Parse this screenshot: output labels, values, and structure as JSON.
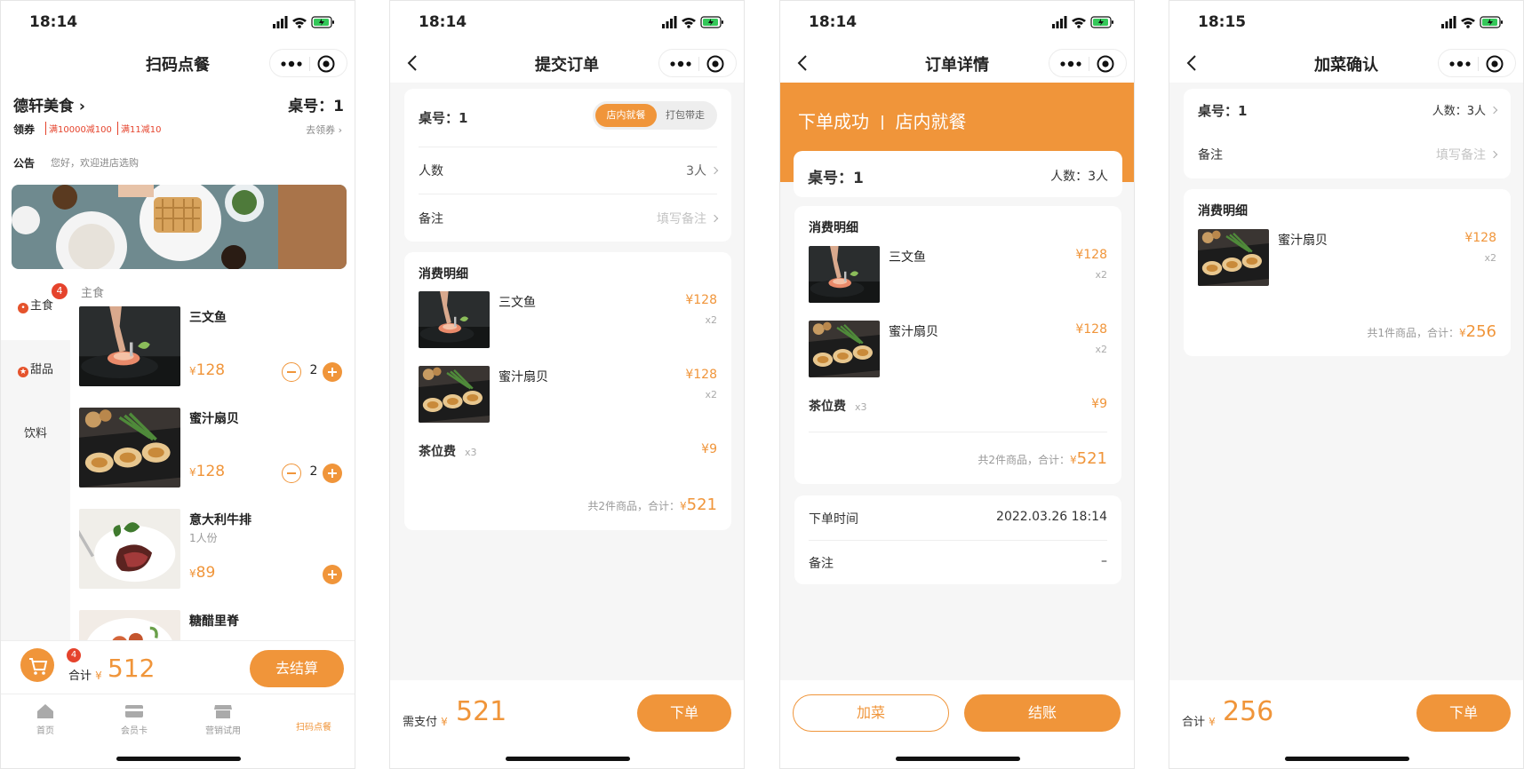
{
  "status": {
    "time1": "18:14",
    "time2": "18:14",
    "time3": "18:14",
    "time4": "18:15"
  },
  "accent_color": "#f0953a",
  "menu": {
    "title": "扫码点餐",
    "shop_name": "德轩美食 ›",
    "table": "桌号：1",
    "coupon_label": "领券",
    "coupons": [
      "满10000减100",
      "满11减10"
    ],
    "coupon_link": "去领券 ›",
    "notice_label": "公告",
    "notice_text": "您好，欢迎进店选购",
    "category_badge": "4",
    "categories": [
      "主食",
      "甜品",
      "饮料"
    ],
    "section_title": "主食",
    "currency": "¥",
    "dishes": [
      {
        "name": "三文鱼",
        "sub": "",
        "price": "128",
        "qty": "2"
      },
      {
        "name": "蜜汁扇贝",
        "sub": "",
        "price": "128",
        "qty": "2"
      },
      {
        "name": "意大利牛排",
        "sub": "1人份",
        "price": "89",
        "qty": ""
      },
      {
        "name": "糖醋里脊",
        "sub": "",
        "price": "",
        "qty": ""
      }
    ],
    "cart_count": "4",
    "total_label": "合计",
    "total_value": "512",
    "checkout": "去结算",
    "tabs": [
      "首页",
      "会员卡",
      "营销试用",
      "扫码点餐"
    ]
  },
  "submit": {
    "title": "提交订单",
    "table": "桌号：1",
    "mode_on": "店内就餐",
    "mode_off": "打包带走",
    "people_label": "人数",
    "people_value": "3人",
    "note_label": "备注",
    "note_placeholder": "填写备注",
    "detail_title": "消费明细",
    "items": [
      {
        "name": "三文鱼",
        "price": "¥128",
        "qty": "x2"
      },
      {
        "name": "蜜汁扇贝",
        "price": "¥128",
        "qty": "x2"
      }
    ],
    "fee_name": "茶位费",
    "fee_qty": "x3",
    "fee_price": "¥9",
    "summary": "共2件商品，合计：",
    "summary_currency": "¥",
    "summary_value": "521",
    "pay_label": "需支付",
    "pay_currency": "¥",
    "pay_value": "521",
    "order_button": "下单"
  },
  "detail": {
    "title": "订单详情",
    "status_main": "下单成功",
    "status_sub": "店内就餐",
    "table": "桌号：1",
    "people": "人数：3人",
    "detail_title": "消费明细",
    "items": [
      {
        "name": "三文鱼",
        "price": "¥128",
        "qty": "x2"
      },
      {
        "name": "蜜汁扇贝",
        "price": "¥128",
        "qty": "x2"
      }
    ],
    "fee_name": "茶位费",
    "fee_qty": "x3",
    "fee_price": "¥9",
    "summary": "共2件商品，合计：",
    "summary_currency": "¥",
    "summary_value": "521",
    "time_label": "下单时间",
    "time_value": "2022.03.26 18:14",
    "note_label": "备注",
    "note_value": "–",
    "add_button": "加菜",
    "pay_button": "结账"
  },
  "addconfirm": {
    "title": "加菜确认",
    "table": "桌号：1",
    "people": "人数：3人",
    "note_label": "备注",
    "note_placeholder": "填写备注",
    "detail_title": "消费明细",
    "item": {
      "name": "蜜汁扇贝",
      "price": "¥128",
      "qty": "x2"
    },
    "summary": "共1件商品，合计：",
    "summary_currency": "¥",
    "summary_value": "256",
    "total_label": "合计",
    "total_currency": "¥",
    "total_value": "256",
    "order_button": "下单"
  }
}
